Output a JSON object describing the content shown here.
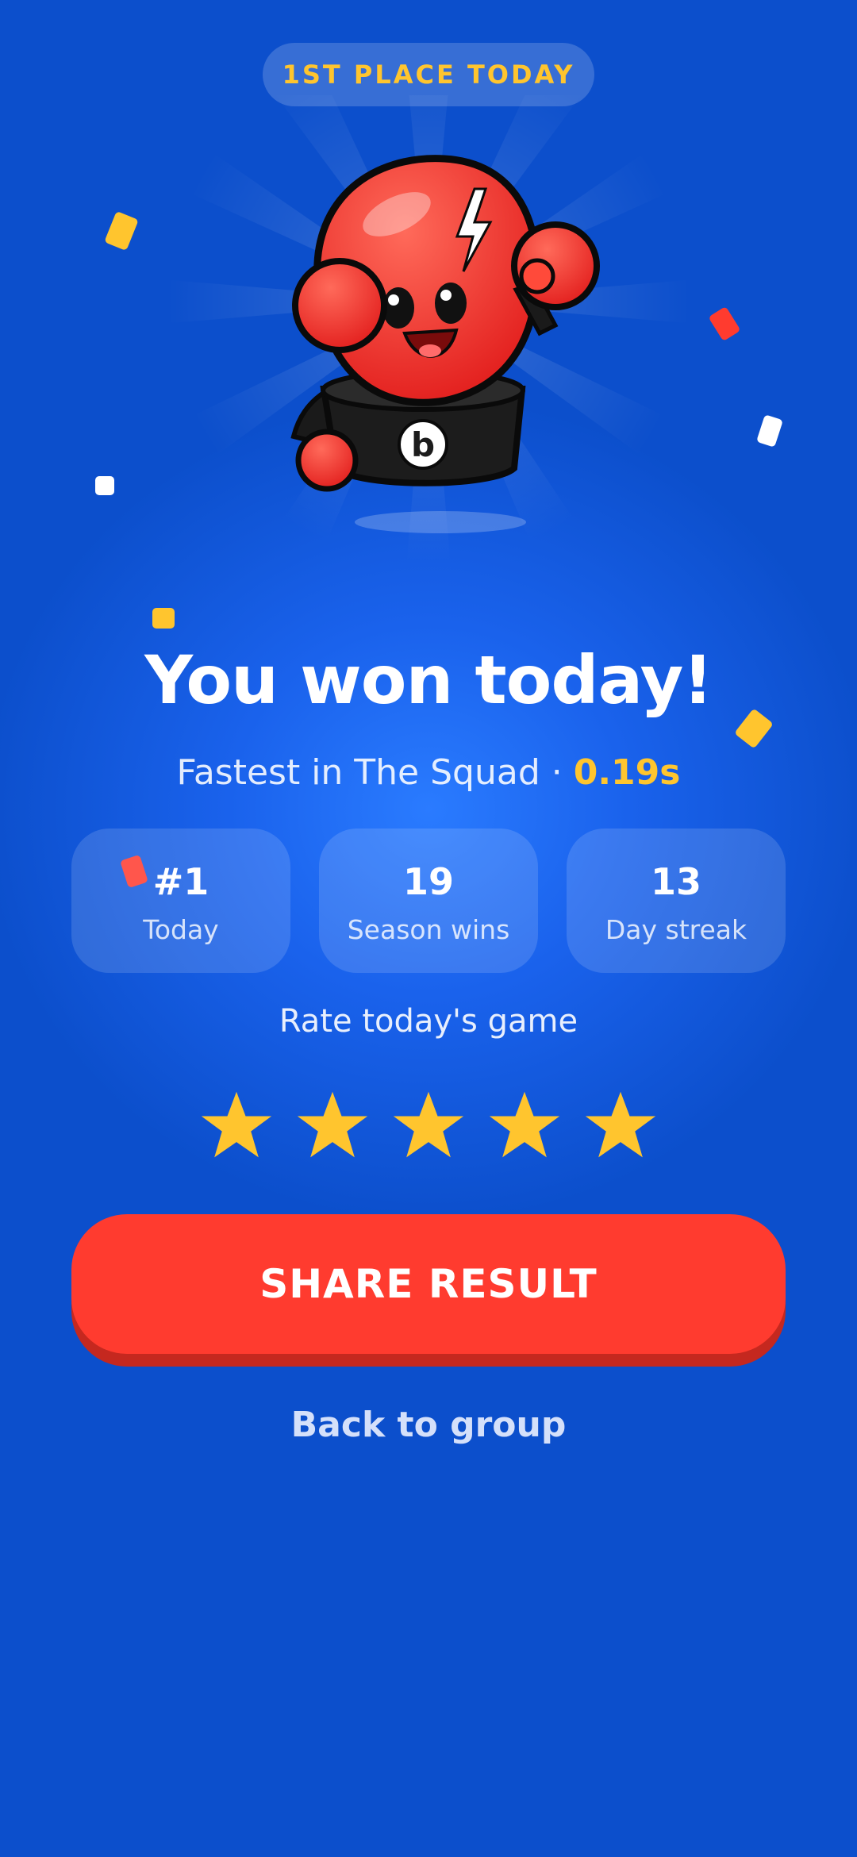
{
  "badge": {
    "label": "1ST PLACE TODAY"
  },
  "result": {
    "title": "You won today!",
    "subtitle_prefix": "Fastest in The Squad · ",
    "subtitle_time": "0.19s"
  },
  "stats": [
    {
      "value": "#1",
      "label": "Today"
    },
    {
      "value": "19",
      "label": "Season wins"
    },
    {
      "value": "13",
      "label": "Day streak"
    }
  ],
  "rating": {
    "label": "Rate today's game",
    "max_stars": 5,
    "filled_stars": 5
  },
  "actions": {
    "share_label": "SHARE RESULT",
    "back_label": "Back to group"
  },
  "mascot": {
    "chest_letter": "b"
  },
  "colors": {
    "background": "#0c4fcc",
    "accent_gold": "#ffc52e",
    "share_button": "#ff3b2f",
    "mascot_red": "#ff2a2a"
  }
}
